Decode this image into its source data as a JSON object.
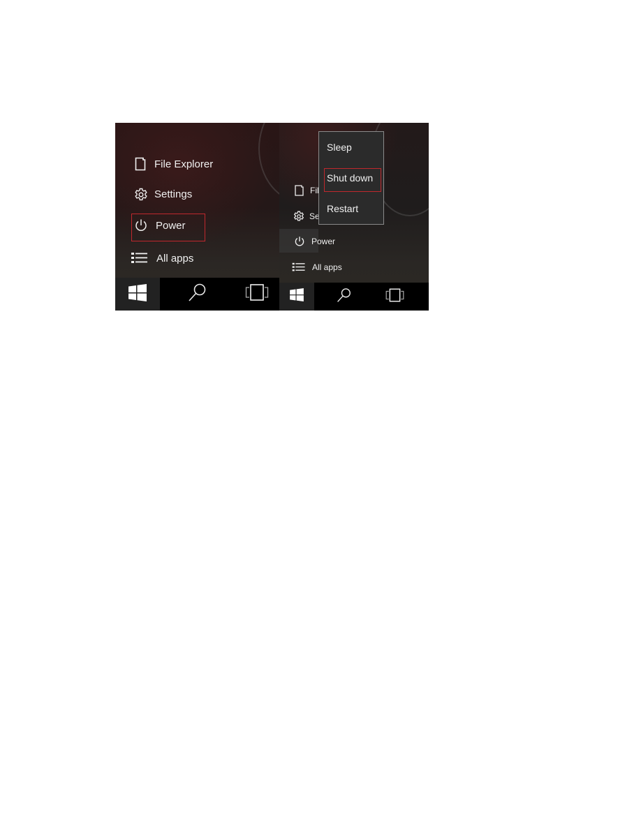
{
  "left_panel": {
    "items": [
      {
        "label": "File Explorer",
        "icon": "file-explorer-icon"
      },
      {
        "label": "Settings",
        "icon": "gear-icon"
      },
      {
        "label": "Power",
        "icon": "power-icon",
        "highlighted": true
      },
      {
        "label": "All apps",
        "icon": "list-icon"
      }
    ],
    "taskbar": {
      "start": "windows-logo-icon",
      "search": "search-icon",
      "task_view": "task-view-icon"
    }
  },
  "right_panel": {
    "items": [
      {
        "label": "File",
        "icon": "file-explorer-icon"
      },
      {
        "label": "Se",
        "icon": "gear-icon"
      },
      {
        "label": "Power",
        "icon": "power-icon",
        "active": true
      },
      {
        "label": "All apps",
        "icon": "list-icon"
      }
    ],
    "power_menu": {
      "items": [
        {
          "label": "Sleep"
        },
        {
          "label": "Shut down",
          "highlighted": true
        },
        {
          "label": "Restart"
        }
      ]
    },
    "taskbar": {
      "start": "windows-logo-icon",
      "search": "search-icon",
      "task_view": "task-view-icon"
    }
  },
  "colors": {
    "highlight_border": "#c0282d",
    "taskbar": "#000000",
    "text": "#f0f0f0"
  }
}
